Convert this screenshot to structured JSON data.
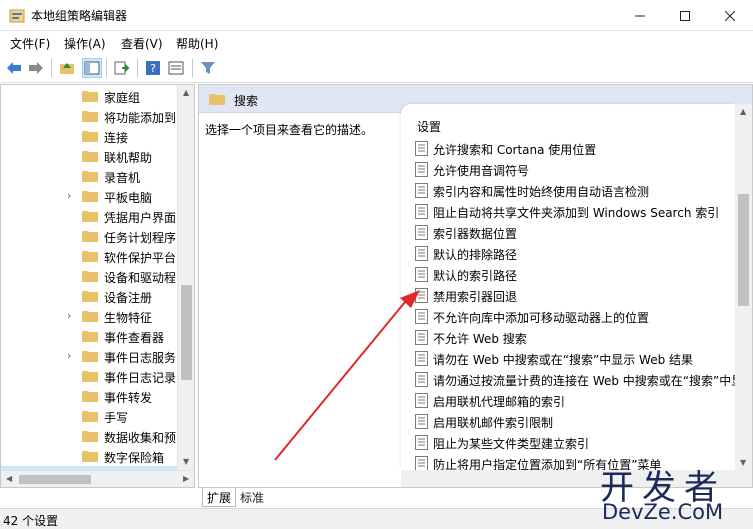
{
  "window": {
    "title": "本地组策略编辑器"
  },
  "menu": [
    "文件(F)",
    "操作(A)",
    "查看(V)",
    "帮助(H)"
  ],
  "toolbar": {
    "icons": [
      "back-arrow-icon",
      "forward-arrow-icon",
      "up-folder-icon",
      "show-hide-tree-icon",
      "export-list-icon",
      "help-icon",
      "properties-icon",
      "filter-icon"
    ]
  },
  "tree": {
    "items": [
      {
        "label": "家庭组",
        "expandable": false
      },
      {
        "label": "将功能添加到",
        "expandable": false
      },
      {
        "label": "连接",
        "expandable": false
      },
      {
        "label": "联机帮助",
        "expandable": false
      },
      {
        "label": "录音机",
        "expandable": false
      },
      {
        "label": "平板电脑",
        "expandable": true
      },
      {
        "label": "凭据用户界面",
        "expandable": false
      },
      {
        "label": "任务计划程序",
        "expandable": false
      },
      {
        "label": "软件保护平台",
        "expandable": false
      },
      {
        "label": "设备和驱动程",
        "expandable": false
      },
      {
        "label": "设备注册",
        "expandable": false
      },
      {
        "label": "生物特征",
        "expandable": true
      },
      {
        "label": "事件查看器",
        "expandable": false
      },
      {
        "label": "事件日志服务",
        "expandable": true
      },
      {
        "label": "事件日志记录",
        "expandable": false
      },
      {
        "label": "事件转发",
        "expandable": false
      },
      {
        "label": "手写",
        "expandable": false
      },
      {
        "label": "数据收集和预",
        "expandable": false
      },
      {
        "label": "数字保险箱",
        "expandable": false
      },
      {
        "label": "搜索",
        "expandable": false,
        "selected": true
      }
    ]
  },
  "right": {
    "header_title": "搜索",
    "description": "选择一个项目来查看它的描述。",
    "column_header": "设置",
    "settings": [
      "允许搜索和 Cortana 使用位置",
      "允许使用音调符号",
      "索引内容和属性时始终使用自动语言检测",
      "阻止自动将共享文件夹添加到 Windows Search 索引",
      "索引器数据位置",
      "默认的排除路径",
      "默认的索引路径",
      "禁用索引器回退",
      "不允许向库中添加可移动驱动器上的位置",
      "不允许 Web 搜索",
      "请勿在 Web 中搜索或在“搜索”中显示 Web 结果",
      "请勿通过按流量计费的连接在 Web 中搜索或在“搜索”中显",
      "启用联机代理邮箱的索引",
      "启用联机邮件索引限制",
      "阻止为某些文件类型建立索引",
      "防止将用户指定位置添加到“所有位置”菜单"
    ]
  },
  "tabs": {
    "extended": "扩展",
    "standard": "标准"
  },
  "status": {
    "text": "42 个设置"
  },
  "watermark": {
    "cn": "开发者",
    "en": "DevZe.CoM"
  },
  "colors": {
    "header_bg": "#dfe7f4",
    "selected_bg": "#cce8ff",
    "arrow": "#e0282a",
    "folder": "#e8c168"
  }
}
